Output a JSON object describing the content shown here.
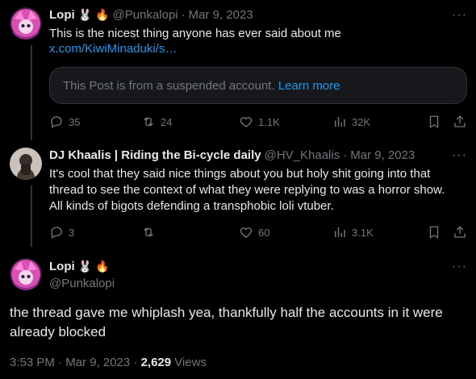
{
  "tweets": [
    {
      "display_name": "Lopi",
      "emojis": [
        "🐰",
        "🔥"
      ],
      "handle": "@Punkalopi",
      "sep": "·",
      "date": "Mar 9, 2023",
      "text": "This is the nicest thing anyone has ever said about me",
      "link": "x.com/KiwiMinaduki/s…",
      "quote_text": "This Post is from a suspended account.",
      "quote_link": "Learn more",
      "replies": "35",
      "reposts": "24",
      "likes": "1.1K",
      "views": "32K"
    },
    {
      "display_name": "DJ Khaalis | Riding the Bi-cycle daily",
      "handle": "@HV_Khaalis",
      "sep": "·",
      "date": "Mar 9, 2023",
      "text_lines": [
        "It's cool that they said nice things about you but holy shit going into that",
        "thread to see the context of what they were replying to was a horror show.",
        "All kinds of bigots defending a transphobic loli vtuber."
      ],
      "replies": "3",
      "reposts": "",
      "likes": "60",
      "views": "3.1K"
    }
  ],
  "main_tweet": {
    "display_name": "Lopi",
    "emojis": [
      "🐰",
      "🔥"
    ],
    "handle": "@Punkalopi",
    "text_lines": [
      "the thread gave me whiplash yea, thankfully half the accounts in it were",
      "already blocked"
    ],
    "time": "3:53 PM · Mar 9, 2023 ·",
    "view_count": "2,629",
    "views_label": "Views"
  },
  "more_icon": "···",
  "colors": {
    "accent": "#1d9bf0",
    "muted": "#71767b",
    "background": "#000000"
  }
}
